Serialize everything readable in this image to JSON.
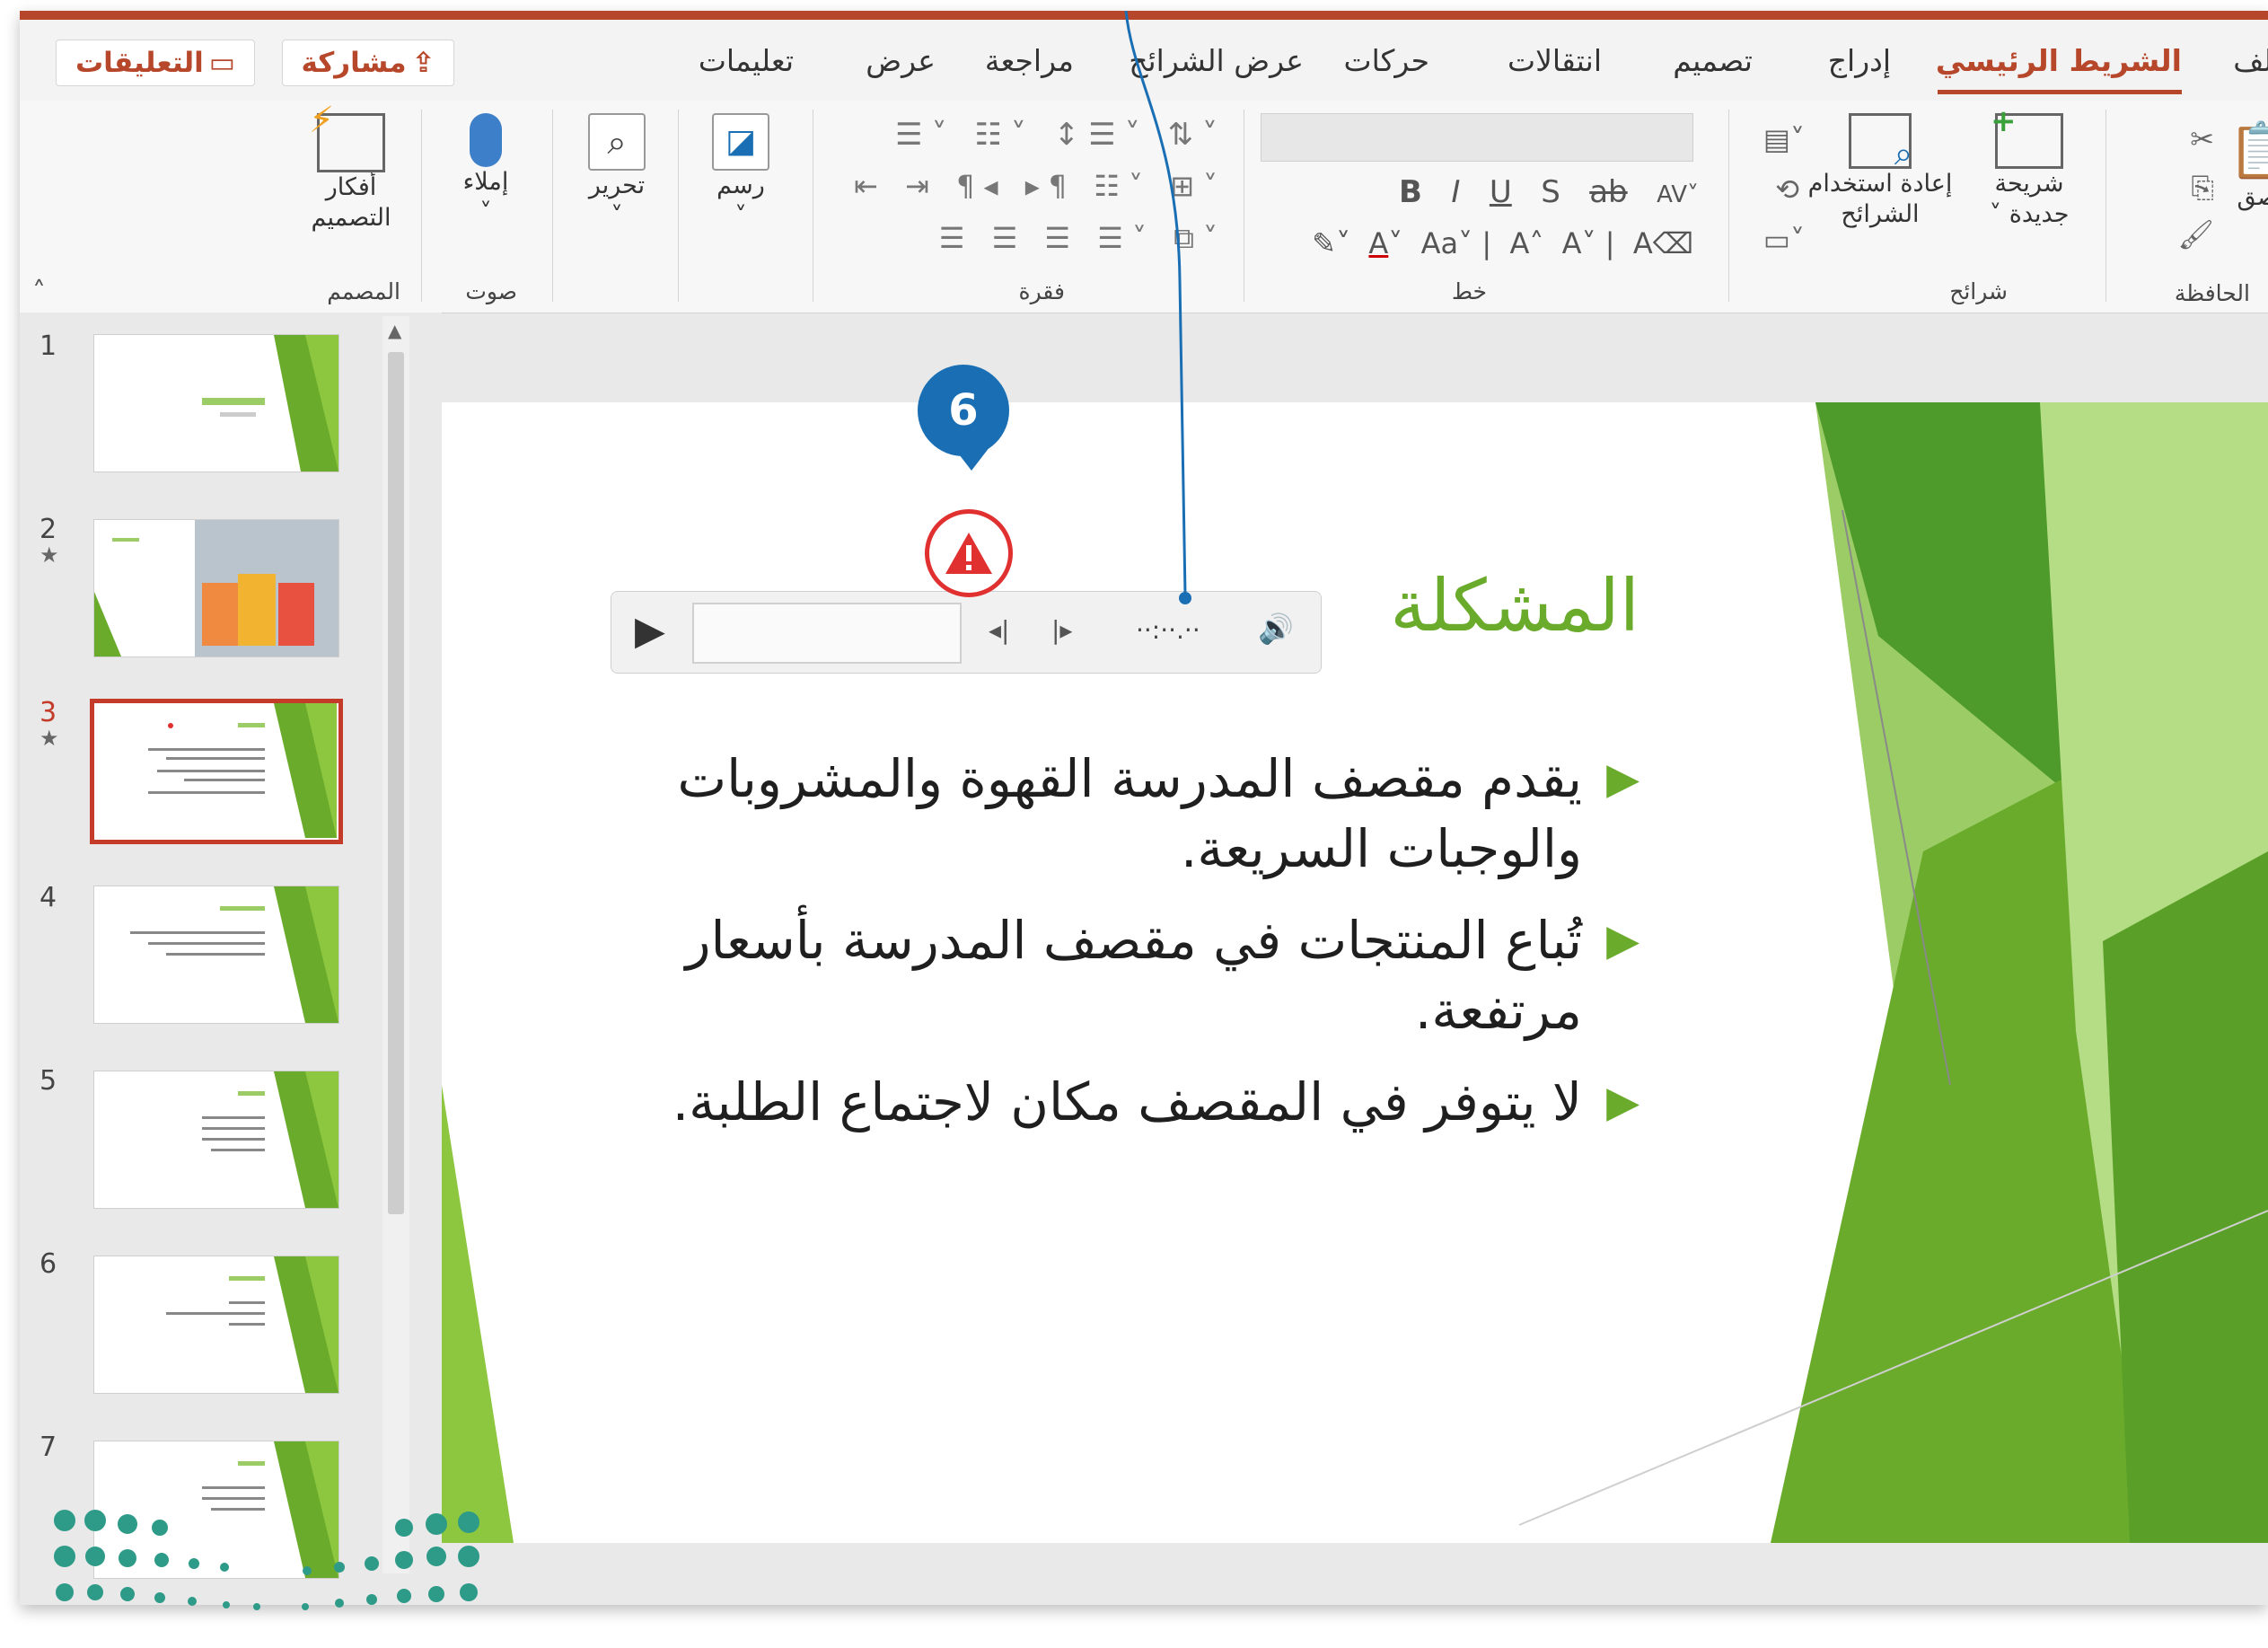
{
  "tabs": {
    "file": "ملف",
    "home": "الشريط الرئيسي",
    "insert": "إدراج",
    "design": "تصميم",
    "transitions": "انتقالات",
    "animations": "حركات",
    "slideshow": "عرض الشرائح",
    "review": "مراجعة",
    "view": "عرض",
    "help": "تعليمات",
    "share": "مشاركة",
    "comments": "التعليقات"
  },
  "ribbon": {
    "clipboard_label": "الحافظة",
    "paste_label": "لصق",
    "new_slide": "شريحة\nجديدة ˅",
    "reuse_slides": "إعادة استخدام\nالشرائح",
    "slides_label": "شرائح",
    "font_label": "خط",
    "paragraph_label": "فقرة",
    "drawing": "رسم",
    "editing": "تحرير",
    "dictate": "إملاء",
    "voice_label": "صوت",
    "design_ideas": "أفكار\nالتصميم",
    "designer_label": "المصمم"
  },
  "thumbnails": [
    {
      "num": "1",
      "star": false
    },
    {
      "num": "2",
      "star": true
    },
    {
      "num": "3",
      "star": true,
      "selected": true
    },
    {
      "num": "4",
      "star": false
    },
    {
      "num": "5",
      "star": false
    },
    {
      "num": "6",
      "star": false
    },
    {
      "num": "7",
      "star": false
    }
  ],
  "slide": {
    "title": "المشكلة",
    "bullets": [
      "يقدم مقصف المدرسة القهوة والمشروبات والوجبات السريعة.",
      "تُباع المنتجات في مقصف المدرسة بأسعار مرتفعة.",
      "لا يتوفر في المقصف مكان لاجتماع الطلبة."
    ]
  },
  "player": {
    "time": "··:··.··"
  },
  "callout": {
    "number": "6"
  },
  "colors": {
    "accent": "#b7472a",
    "slide_green": "#6aab2c",
    "callout_blue": "#1a6fb4",
    "warning_red": "#e03030"
  }
}
